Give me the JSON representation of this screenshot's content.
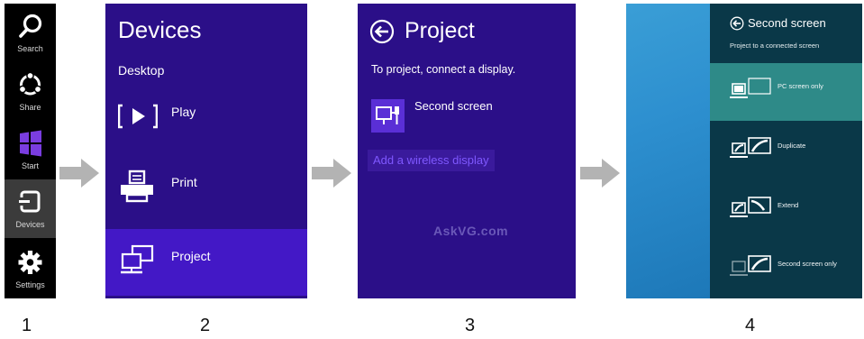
{
  "charms": {
    "items": [
      {
        "label": "Search",
        "icon": "search-icon"
      },
      {
        "label": "Share",
        "icon": "share-icon"
      },
      {
        "label": "Start",
        "icon": "windows-logo-icon"
      },
      {
        "label": "Devices",
        "icon": "devices-icon",
        "active": true
      },
      {
        "label": "Settings",
        "icon": "gear-icon"
      }
    ]
  },
  "devices_panel": {
    "title": "Devices",
    "subtitle": "Desktop",
    "items": [
      {
        "label": "Play",
        "icon": "play-icon"
      },
      {
        "label": "Print",
        "icon": "printer-icon"
      },
      {
        "label": "Project",
        "icon": "project-icon",
        "selected": true
      }
    ]
  },
  "project_panel": {
    "title": "Project",
    "instruction": "To project, connect a display.",
    "second_screen_label": "Second screen",
    "wireless_link": "Add a wireless display",
    "watermark": "AskVG.com"
  },
  "second_screen_panel": {
    "title": "Second screen",
    "subtitle": "Project to a connected screen",
    "options": [
      {
        "label": "PC screen only",
        "selected": true
      },
      {
        "label": "Duplicate"
      },
      {
        "label": "Extend"
      },
      {
        "label": "Second screen only"
      }
    ]
  },
  "step_numbers": [
    "1",
    "2",
    "3",
    "4"
  ],
  "colors": {
    "charms_bg": "#000000",
    "devices_bg": "#2b0f88",
    "devices_selected": "#4318c6",
    "second_screen_bg": "#0a3848",
    "second_screen_selected": "#2e8a88",
    "arrow": "#b3b3b3"
  }
}
